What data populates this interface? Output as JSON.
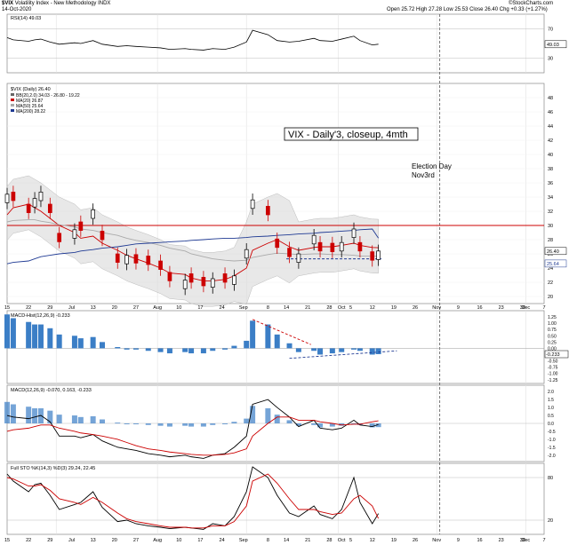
{
  "header": {
    "symbol": "$VIX",
    "name": "Volatility Index - New Methodology",
    "exchange": "INDX",
    "date": "14-Oct-2020",
    "ohlc": "Open 25.72  High 27.28  Low 25.53  Close 26.40  Chg +0.33 (+1.27%)",
    "watermark": "©StockCharts.com"
  },
  "colors": {
    "price_up": "#000000",
    "price_down": "#cc0000",
    "ma20": "#cc0000",
    "ma50": "#aaaaaa",
    "ma200": "#1f3a93",
    "bollinger_fill": "#d9d9d9",
    "histogram": "#3b7ec6",
    "annotation": "#000000",
    "resistance": "#cc0000",
    "support": "#1f3a93"
  },
  "rsi_panel": {
    "legend": "RSI(14) 49.03",
    "levels": [
      "70",
      "30"
    ],
    "badge": "49.03"
  },
  "price_panel": {
    "legend": "$VIX (Daily) 26.40",
    "ma_legend": [
      "BB(20,2.0) 34.03 - 26.80 - 19.22",
      "MA(20) 26.87",
      "MA(50) 25.64",
      "MA(200) 28.22"
    ],
    "title_box": "VIX - Daily'3, closeup, 4mth",
    "event_label_1": "Election Day",
    "event_label_2": "Nov3rd",
    "price_badge": "26.40",
    "ma50_badge": "25.64",
    "y_ticks": [
      "48",
      "46",
      "44",
      "42",
      "40",
      "38",
      "36",
      "34",
      "32",
      "30",
      "28",
      "26",
      "24",
      "22",
      "20"
    ]
  },
  "hist_panel": {
    "legend": "MACD-Hist(12,26,9) -0.233",
    "y_ticks": [
      "1.25",
      "1.00",
      "0.75",
      "0.50",
      "0.25",
      "0.00",
      "-0.25",
      "-0.50",
      "-0.75",
      "-1.00",
      "-1.25"
    ],
    "badge": "-0.233"
  },
  "macd_panel": {
    "legend": "MACD(12,26,9) -0.070, 0.163, -0.233",
    "y_ticks": [
      "2.0",
      "1.5",
      "1.0",
      "0.5",
      "0.0",
      "-0.5",
      "-1.0",
      "-1.5",
      "-2.0"
    ]
  },
  "sto_panel": {
    "legend": "Full STO %K(14,3) %D(3) 29.24, 22.45",
    "levels": [
      "80",
      "20"
    ]
  },
  "x_axis": {
    "labels": [
      "15",
      "22",
      "29",
      "Jul",
      "13",
      "20",
      "27",
      "Aug",
      "10",
      "17",
      "24",
      "Sep",
      "8",
      "14",
      "21",
      "28",
      "Oct",
      "5",
      "12",
      "19",
      "26",
      "Nov",
      "9",
      "16",
      "23",
      "30",
      "Dec",
      "7"
    ]
  },
  "chart_data": {
    "type": "candlestick",
    "title": "$VIX Volatility Index - New Methodology INDX",
    "x_range": [
      "2020-06-15",
      "2020-12-07"
    ],
    "ylim": [
      19,
      50
    ],
    "resistance_level": 30.0,
    "support_level": 25.3,
    "candles": [
      {
        "date": "2020-06-15",
        "close": 34.4,
        "dir": "up"
      },
      {
        "date": "2020-06-17",
        "close": 33.5,
        "dir": "down"
      },
      {
        "date": "2020-06-22",
        "close": 31.8,
        "dir": "down"
      },
      {
        "date": "2020-06-24",
        "close": 33.8,
        "dir": "up"
      },
      {
        "date": "2020-06-26",
        "close": 34.7,
        "dir": "up"
      },
      {
        "date": "2020-06-29",
        "close": 31.8,
        "dir": "down"
      },
      {
        "date": "2020-07-02",
        "close": 27.7,
        "dir": "down"
      },
      {
        "date": "2020-07-07",
        "close": 29.4,
        "dir": "up"
      },
      {
        "date": "2020-07-09",
        "close": 29.3,
        "dir": "down"
      },
      {
        "date": "2020-07-13",
        "close": 32.2,
        "dir": "up"
      },
      {
        "date": "2020-07-16",
        "close": 28.0,
        "dir": "down"
      },
      {
        "date": "2020-07-21",
        "close": 24.8,
        "dir": "down"
      },
      {
        "date": "2020-07-24",
        "close": 25.8,
        "dir": "up"
      },
      {
        "date": "2020-07-27",
        "close": 24.7,
        "dir": "down"
      },
      {
        "date": "2020-07-31",
        "close": 24.5,
        "dir": "down"
      },
      {
        "date": "2020-08-04",
        "close": 23.8,
        "dir": "down"
      },
      {
        "date": "2020-08-07",
        "close": 22.2,
        "dir": "down"
      },
      {
        "date": "2020-08-12",
        "close": 22.3,
        "dir": "up"
      },
      {
        "date": "2020-08-14",
        "close": 22.0,
        "dir": "down"
      },
      {
        "date": "2020-08-18",
        "close": 21.5,
        "dir": "down"
      },
      {
        "date": "2020-08-21",
        "close": 22.5,
        "dir": "up"
      },
      {
        "date": "2020-08-25",
        "close": 22.0,
        "dir": "down"
      },
      {
        "date": "2020-08-28",
        "close": 22.9,
        "dir": "up"
      },
      {
        "date": "2020-09-01",
        "close": 26.6,
        "dir": "up"
      },
      {
        "date": "2020-09-03",
        "close": 33.6,
        "dir": "up"
      },
      {
        "date": "2020-09-08",
        "close": 31.5,
        "dir": "down"
      },
      {
        "date": "2020-09-11",
        "close": 26.9,
        "dir": "down"
      },
      {
        "date": "2020-09-15",
        "close": 25.6,
        "dir": "down"
      },
      {
        "date": "2020-09-18",
        "close": 26.0,
        "dir": "up"
      },
      {
        "date": "2020-09-23",
        "close": 28.6,
        "dir": "up"
      },
      {
        "date": "2020-09-25",
        "close": 26.4,
        "dir": "down"
      },
      {
        "date": "2020-09-29",
        "close": 26.3,
        "dir": "down"
      },
      {
        "date": "2020-10-02",
        "close": 27.6,
        "dir": "up"
      },
      {
        "date": "2020-10-06",
        "close": 29.5,
        "dir": "up"
      },
      {
        "date": "2020-10-08",
        "close": 26.4,
        "dir": "down"
      },
      {
        "date": "2020-10-12",
        "close": 25.1,
        "dir": "down"
      },
      {
        "date": "2020-10-14",
        "close": 26.4,
        "dir": "up"
      }
    ],
    "series": [
      {
        "name": "MA(20)",
        "values": [
          31.5,
          32.5,
          33.0,
          32.5,
          32.0,
          31.0,
          30.0,
          29.0,
          28.2,
          28.5,
          27.5,
          26.5,
          25.8,
          25.3,
          24.7,
          24.0,
          23.3,
          23.1,
          22.6,
          22.2,
          22.2,
          22.4,
          22.9,
          24.0,
          26.5,
          27.5,
          28.0,
          27.0,
          26.5,
          26.9,
          27.0,
          27.0,
          27.2,
          27.5,
          27.2,
          26.9,
          26.87
        ]
      },
      {
        "name": "MA(50)",
        "values": [
          30.5,
          30.7,
          30.8,
          30.8,
          30.6,
          30.4,
          30.1,
          29.8,
          29.5,
          29.3,
          29.0,
          28.6,
          28.2,
          27.9,
          27.6,
          27.2,
          26.8,
          26.4,
          26.0,
          25.6,
          25.3,
          25.1,
          25.0,
          25.1,
          25.5,
          25.9,
          26.1,
          26.0,
          25.9,
          26.0,
          26.0,
          25.9,
          25.9,
          25.8,
          25.7,
          25.7,
          25.64
        ]
      },
      {
        "name": "MA(200)",
        "values": [
          24.6,
          24.8,
          25.0,
          25.3,
          25.6,
          25.8,
          26.0,
          26.2,
          26.4,
          26.6,
          26.8,
          27.0,
          27.2,
          27.4,
          27.5,
          27.6,
          27.7,
          27.8,
          27.9,
          28.0,
          28.1,
          28.2,
          28.2,
          28.3,
          28.4,
          28.5,
          28.6,
          28.7,
          28.8,
          28.9,
          29.0,
          29.1,
          29.2,
          29.3,
          29.4,
          29.5,
          28.22
        ]
      }
    ],
    "rsi_values": [
      58,
      55,
      53,
      55,
      56,
      52,
      49,
      51,
      50,
      54,
      49,
      46,
      47,
      46,
      45,
      44,
      42,
      43,
      42,
      41,
      43,
      42,
      45,
      52,
      68,
      62,
      54,
      52,
      53,
      57,
      54,
      53,
      56,
      60,
      54,
      48,
      49.03
    ],
    "macd_hist_values": [
      1.35,
      1.2,
      1.05,
      0.95,
      0.95,
      0.8,
      0.55,
      0.5,
      0.4,
      0.45,
      0.25,
      0.05,
      -0.05,
      -0.05,
      -0.1,
      -0.15,
      -0.2,
      -0.15,
      -0.2,
      -0.2,
      -0.1,
      -0.05,
      0.1,
      0.3,
      1.1,
      0.95,
      0.55,
      0.2,
      -0.15,
      -0.1,
      -0.25,
      -0.2,
      -0.15,
      -0.05,
      -0.1,
      -0.25,
      -0.233
    ],
    "macd_values": [
      0.5,
      0.4,
      0.3,
      0.4,
      0.5,
      0.1,
      -0.8,
      -0.8,
      -0.9,
      -0.7,
      -1.1,
      -1.5,
      -1.6,
      -1.7,
      -1.9,
      -2.0,
      -2.1,
      -2.0,
      -2.1,
      -2.2,
      -2.0,
      -1.9,
      -1.5,
      -0.8,
      1.2,
      1.5,
      1.0,
      0.4,
      -0.2,
      0.2,
      -0.3,
      -0.4,
      -0.3,
      0.2,
      -0.1,
      -0.2,
      -0.07
    ],
    "macd_signal_values": [
      -0.5,
      -0.4,
      -0.3,
      -0.2,
      -0.1,
      -0.1,
      -0.3,
      -0.5,
      -0.6,
      -0.7,
      -0.8,
      -1.0,
      -1.2,
      -1.4,
      -1.6,
      -1.7,
      -1.8,
      -1.9,
      -1.95,
      -2.0,
      -2.0,
      -1.95,
      -1.85,
      -1.6,
      -0.8,
      0.0,
      0.4,
      0.4,
      0.2,
      0.2,
      0.1,
      0.0,
      -0.1,
      -0.05,
      -0.05,
      0.1,
      0.163
    ],
    "sto_k": [
      85,
      75,
      60,
      70,
      72,
      55,
      35,
      42,
      45,
      60,
      38,
      18,
      20,
      15,
      12,
      10,
      8,
      10,
      9,
      7,
      15,
      12,
      25,
      60,
      95,
      80,
      55,
      30,
      25,
      40,
      28,
      22,
      35,
      80,
      45,
      15,
      29.24
    ],
    "sto_d": [
      80,
      78,
      68,
      68,
      70,
      62,
      50,
      45,
      42,
      52,
      45,
      30,
      22,
      18,
      15,
      12,
      10,
      10,
      9,
      9,
      12,
      12,
      18,
      40,
      75,
      85,
      72,
      50,
      35,
      35,
      32,
      28,
      30,
      50,
      55,
      40,
      22.45
    ]
  }
}
